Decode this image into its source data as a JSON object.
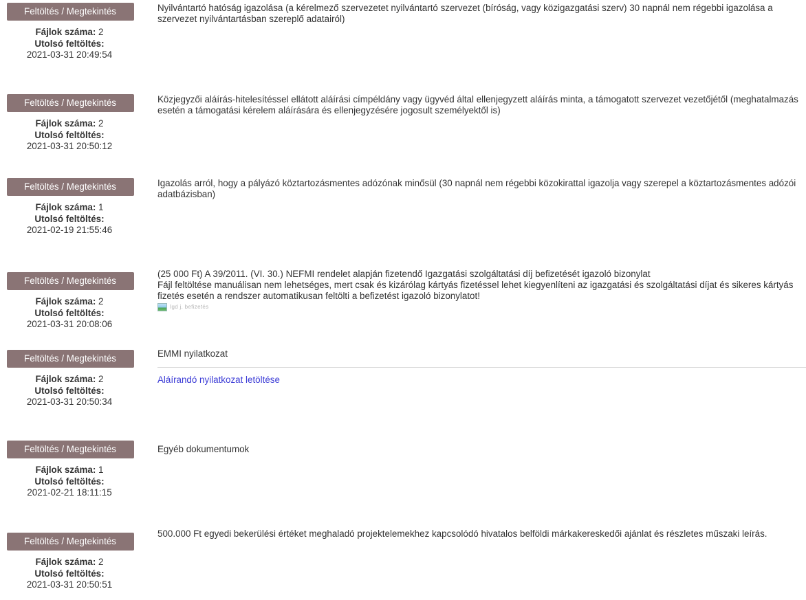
{
  "items": [
    {
      "button_label": "Feltöltés / Megtekintés",
      "files_label": "Fájlok száma:",
      "files_count": "2",
      "last_upload_label": "Utolsó feltöltés:",
      "last_upload": "2021-03-31 20:49:54",
      "description": "Nyilvántartó hatóság igazolása (a kérelmező szervezetet nyilvántartó szervezet (bíróság, vagy közigazgatási szerv) 30 napnál nem régebbi igazolása a szervezet nyilvántartásban szereplő adatairól)"
    },
    {
      "button_label": "Feltöltés / Megtekintés",
      "files_label": "Fájlok száma:",
      "files_count": "2",
      "last_upload_label": "Utolsó feltöltés:",
      "last_upload": "2021-03-31 20:50:12",
      "description": "Közjegyzői aláírás-hitelesítéssel ellátott aláírási címpéldány vagy ügyvéd által ellenjegyzett aláírás minta, a támogatott szervezet vezetőjétől (meghatalmazás esetén a támogatási kérelem aláírására és ellenjegyzésére jogosult személyektől is)"
    },
    {
      "button_label": "Feltöltés / Megtekintés",
      "files_label": "Fájlok száma:",
      "files_count": "1",
      "last_upload_label": "Utolsó feltöltés:",
      "last_upload": "2021-02-19 21:55:46",
      "description": "Igazolás arról, hogy a pályázó köztartozásmentes adózónak minősül (30 napnál nem régebbi közokirattal igazolja vagy szerepel a köztartozásmentes adózói adatbázisban)"
    },
    {
      "button_label": "Feltöltés / Megtekintés",
      "files_label": "Fájlok száma:",
      "files_count": "2",
      "last_upload_label": "Utolsó feltöltés:",
      "last_upload": "2021-03-31 20:08:06",
      "description_lines": [
        "(25 000 Ft) A 39/2011. (VI. 30.) NEFMI rendelet alapján fizetendő Igazgatási szolgáltatási díj befizetését igazoló bizonylat",
        "Fájl feltöltése manuálisan nem lehetséges, mert csak és kizárólag kártyás fizetéssel lehet kiegyenlíteni az igazgatási és szolgáltatási díjat és sikeres kártyás fizetés esetén a rendszer automatikusan feltölti a befizetést igazoló bizonylatot!"
      ],
      "image_alt": "Igd j. befizetés",
      "image_icon": "broken-image-icon"
    },
    {
      "button_label": "Feltöltés / Megtekintés",
      "files_label": "Fájlok száma:",
      "files_count": "2",
      "last_upload_label": "Utolsó feltöltés:",
      "last_upload": "2021-03-31 20:50:34",
      "description": "EMMI nyilatkozat",
      "link_label": "Aláírandó nyilatkozat letöltése",
      "link_color": "#3b3bd6"
    },
    {
      "button_label": "Feltöltés / Megtekintés",
      "files_label": "Fájlok száma:",
      "files_count": "1",
      "last_upload_label": "Utolsó feltöltés:",
      "last_upload": "2021-02-21 18:11:15",
      "description": "Egyéb dokumentumok"
    },
    {
      "button_label": "Feltöltés / Megtekintés",
      "files_label": "Fájlok száma:",
      "files_count": "2",
      "last_upload_label": "Utolsó feltöltés:",
      "last_upload": "2021-03-31 20:50:51",
      "description": "500.000 Ft egyedi bekerülési értéket meghaladó projektelemekhez kapcsolódó hivatalos belföldi márkakereskedői ajánlat és részletes műszaki leírás."
    }
  ],
  "colors": {
    "button_bg": "#8a7475",
    "button_text": "#ffffff",
    "link": "#3b3bd6",
    "text": "#333333"
  }
}
